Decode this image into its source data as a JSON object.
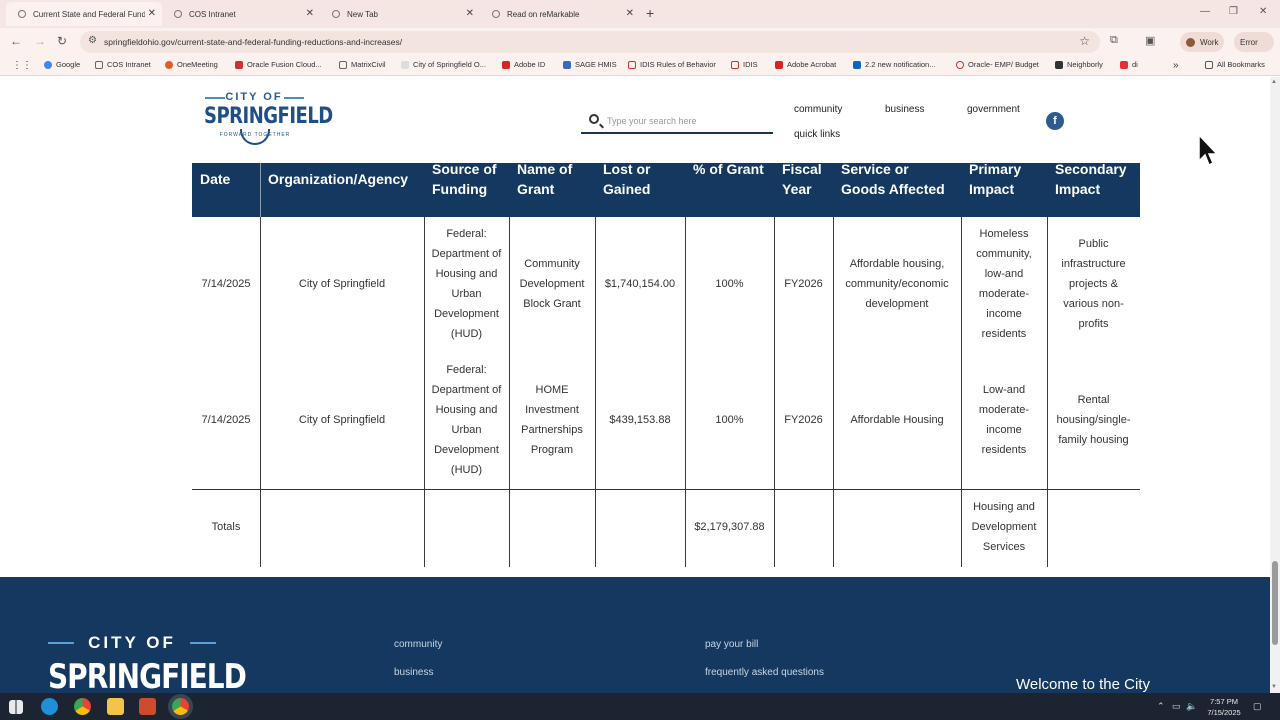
{
  "browser": {
    "tabs": [
      {
        "title": "Current State and Federal Fund",
        "active": true
      },
      {
        "title": "COS Intranet",
        "active": false
      },
      {
        "title": "New Tab",
        "active": false
      },
      {
        "title": "Read on reMarkable",
        "active": false
      }
    ],
    "url": "springfieldohio.gov/current-state-and-federal-funding-reductions-and-increases/",
    "profile_label": "Work",
    "error_label": "Error",
    "bookmarks": [
      "Google",
      "COS Intranet",
      "OneMeeting",
      "Oracle Fusion Cloud...",
      "MatrixCivil",
      "City of Springfield O...",
      "Adobe ID",
      "SAGE HMIS",
      "IDIS Rules of Behavior",
      "IDIS",
      "Adobe Acrobat",
      "2.2 new notification...",
      "Oracle- EMP/ Budget",
      "Neighborly",
      "di"
    ],
    "all_bookmarks": "All Bookmarks"
  },
  "site": {
    "logo": {
      "city_of": "CITY OF",
      "name": "SPRINGFIELD",
      "tagline": "FORWARD TOGETHER"
    },
    "search_placeholder": "Type your search here",
    "nav": [
      "community",
      "business",
      "government",
      "quick links"
    ],
    "facebook": "f"
  },
  "table": {
    "headers": [
      "Date",
      "Organization/Agency",
      "Source of Funding",
      "Name of Grant",
      "Dollars Lost or Gained",
      "% of Grant",
      "Fiscal Year",
      "Service or Goods Affected",
      "Primary Impact",
      "Secondary Impact"
    ],
    "rows": [
      {
        "date": "7/14/2025",
        "org": "City of Springfield",
        "source": "Federal: Department of Housing and Urban Development (HUD)",
        "grant": "Community Development Block Grant",
        "amount": "$1,740,154.00",
        "pct": "100%",
        "fy": "FY2026",
        "service": "Affordable housing, community/economic development",
        "primary": "Homeless community, low-and moderate-income residents",
        "secondary": "Public infrastructure projects & various non-profits"
      },
      {
        "date": "7/14/2025",
        "org": "City of Springfield",
        "source": "Federal: Department of Housing and Urban Development (HUD)",
        "grant": "HOME Investment Partnerships Program",
        "amount": "$439,153.88",
        "pct": "100%",
        "fy": "FY2026",
        "service": "Affordable Housing",
        "primary": "Low-and moderate-income residents",
        "secondary": "Rental housing/single-family housing"
      }
    ],
    "totals": {
      "label": "Totals",
      "amount": "$2,179,307.88",
      "primary": "Housing and Development Services"
    }
  },
  "footer": {
    "city_of": "CITY OF",
    "name": "SPRINGFIELD",
    "links_col1": [
      "community",
      "business"
    ],
    "links_col2": [
      "pay your bill",
      "frequently asked questions"
    ],
    "welcome": "Welcome to the City"
  },
  "taskbar": {
    "time": "7:57 PM",
    "date": "7/15/2025"
  }
}
